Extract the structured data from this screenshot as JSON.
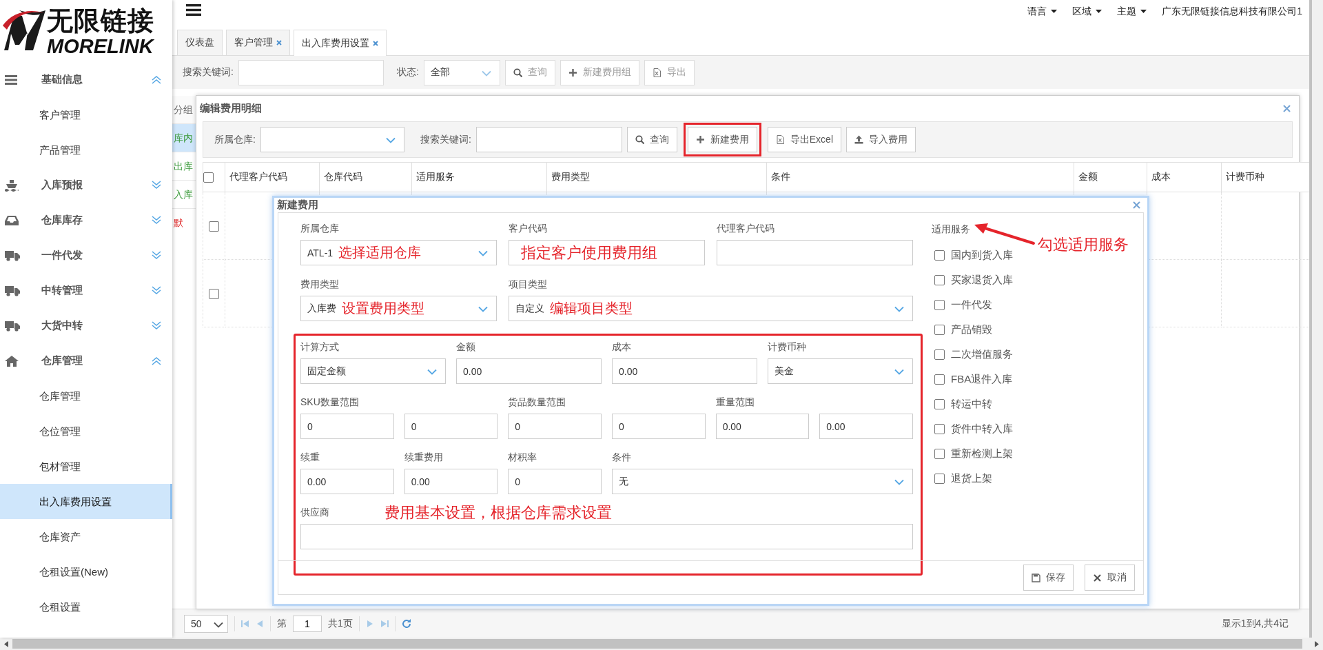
{
  "brand": {
    "name": "无限链接",
    "latin": "MORELINK"
  },
  "sidebar": {
    "items": [
      {
        "label": "基础信息",
        "expanded": true,
        "children": [
          {
            "label": "客户管理",
            "selected": false
          },
          {
            "label": "产品管理",
            "selected": false
          }
        ]
      },
      {
        "label": "入库预报",
        "expanded": false
      },
      {
        "label": "仓库库存",
        "expanded": false
      },
      {
        "label": "一件代发",
        "expanded": false
      },
      {
        "label": "中转管理",
        "expanded": false
      },
      {
        "label": "大货中转",
        "expanded": false
      },
      {
        "label": "仓库管理",
        "expanded": true,
        "children": [
          {
            "label": "仓库管理",
            "selected": false
          },
          {
            "label": "仓位管理",
            "selected": false
          },
          {
            "label": "包材管理",
            "selected": false
          },
          {
            "label": "出入库费用设置",
            "selected": true
          },
          {
            "label": "仓库资产",
            "selected": false
          },
          {
            "label": "仓租设置(New)",
            "selected": false
          },
          {
            "label": "仓租设置",
            "selected": false
          }
        ]
      }
    ]
  },
  "header": {
    "menus": [
      {
        "label": "语言"
      },
      {
        "label": "区域"
      },
      {
        "label": "主题"
      }
    ],
    "company": "广东无限链接信息科技有限公司1"
  },
  "tabs": [
    {
      "label": "仪表盘",
      "closable": false,
      "selected": false
    },
    {
      "label": "客户管理",
      "closable": true,
      "selected": false
    },
    {
      "label": "出入库费用设置",
      "closable": true,
      "selected": true
    }
  ],
  "toolbar": {
    "search_label": "搜索关键词:",
    "status_label": "状态:",
    "status_value": "全部",
    "buttons": [
      {
        "label": "查询"
      },
      {
        "label": "新建费用组"
      },
      {
        "label": "导出"
      }
    ]
  },
  "group_list": {
    "title": "分组",
    "items": [
      {
        "label": "库内",
        "color": "#3a9a3a",
        "selected": true
      },
      {
        "label": "出库",
        "color": "#3a9a3a",
        "selected": false
      },
      {
        "label": "入库",
        "color": "#3a9a3a",
        "selected": false
      },
      {
        "label": "默",
        "color": "#e03030",
        "selected": false
      }
    ]
  },
  "panel": {
    "title": "编辑费用明细",
    "warehouse_label": "所属仓库:",
    "keyword_label": "搜索关键词:",
    "buttons": [
      {
        "label": "查询",
        "highlighted": false
      },
      {
        "label": "新建费用",
        "highlighted": true
      },
      {
        "label": "导出Excel",
        "highlighted": false
      },
      {
        "label": "导入费用",
        "highlighted": false
      }
    ],
    "table": {
      "columns": [
        "代理客户代码",
        "仓库代码",
        "适用服务",
        "费用类型",
        "条件",
        "金额",
        "成本",
        "计费币种"
      ],
      "all_checked": false,
      "rows": [
        {
          "checked": false
        },
        {
          "checked": false
        }
      ]
    }
  },
  "pagination": {
    "page_size": "50",
    "page_prefix": "第",
    "page": "1",
    "page_suffix": "共1页",
    "summary": "显示1到4,共4记"
  },
  "dialog": {
    "title": "新建费用",
    "top_groups": [
      {
        "fields": [
          {
            "label": "所属仓库",
            "kind": "select",
            "value": "ATL-1",
            "note": "选择适用仓库"
          },
          {
            "label": "客户代码",
            "kind": "input",
            "note": "指定客户使用费用组"
          },
          {
            "label": "代理客户代码",
            "kind": "input"
          }
        ]
      },
      {
        "fields": [
          {
            "label": "费用类型",
            "kind": "select",
            "value": "入库费",
            "note": "设置费用类型"
          },
          {
            "label": "项目类型",
            "kind": "select",
            "value": "自定义",
            "note": "编辑项目类型"
          }
        ]
      }
    ],
    "fee_section": {
      "highlighted": true,
      "note": "费用基本设置，根据仓库需求设置",
      "groups": [
        {
          "fields": [
            {
              "label": "计算方式",
              "kind": "select",
              "value": "固定金额"
            },
            {
              "label": "金额",
              "kind": "input",
              "value": "0.00"
            },
            {
              "label": "成本",
              "kind": "input",
              "value": "0.00"
            },
            {
              "label": "计费币种",
              "kind": "select",
              "value": "美金"
            }
          ]
        },
        {
          "fields": [
            {
              "label": "SKU数量范围",
              "kind": "range",
              "values": [
                "0",
                "0"
              ]
            },
            {
              "label": "货品数量范围",
              "kind": "range",
              "values": [
                "0",
                "0"
              ]
            },
            {
              "label": "重量范围",
              "kind": "range",
              "values": [
                "0.00",
                "0.00"
              ]
            }
          ]
        },
        {
          "fields": [
            {
              "label": "续重",
              "kind": "input",
              "value": "0.00"
            },
            {
              "label": "续重费用",
              "kind": "input",
              "value": "0.00"
            },
            {
              "label": "材积率",
              "kind": "input",
              "value": "0"
            },
            {
              "label": "条件",
              "kind": "select",
              "value": "无"
            }
          ]
        },
        {
          "fields": [
            {
              "label": "供应商",
              "kind": "input"
            }
          ]
        }
      ]
    },
    "services": {
      "title": "适用服务",
      "note": "勾选适用服务",
      "items": [
        {
          "label": "国内到货入库",
          "checked": false
        },
        {
          "label": "买家退货入库",
          "checked": false
        },
        {
          "label": "一件代发",
          "checked": false
        },
        {
          "label": "产品销毁",
          "checked": false
        },
        {
          "label": "二次增值服务",
          "checked": false
        },
        {
          "label": "FBA退件入库",
          "checked": false
        },
        {
          "label": "转运中转",
          "checked": false
        },
        {
          "label": "货件中转入库",
          "checked": false
        },
        {
          "label": "重新检测上架",
          "checked": false
        },
        {
          "label": "退货上架",
          "checked": false
        }
      ]
    },
    "buttons": [
      {
        "label": "保存"
      },
      {
        "label": "取消"
      }
    ]
  }
}
